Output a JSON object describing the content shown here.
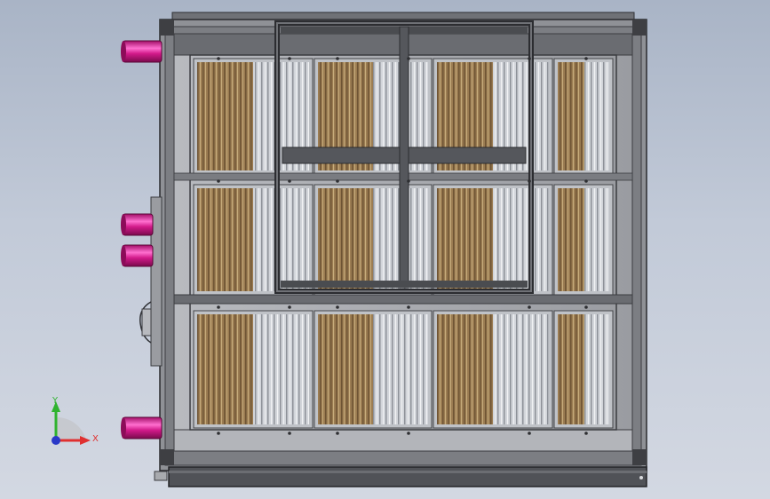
{
  "view": {
    "model": "air-handling-unit-heat-exchanger",
    "background_top": "#a9b4c6",
    "background_bottom": "#d3d8e2"
  },
  "colors": {
    "frame": "#5f6166",
    "frame_dark": "#3a3b3f",
    "panel": "#a8aaae",
    "pipe": "#d21a8a",
    "pipe_highlight": "#ff6fcf",
    "fin_wood_a": "#8e7048",
    "fin_wood_b": "#b49a6c",
    "fin_metal_a": "#c9ccd2",
    "fin_metal_b": "#9fa3aa"
  },
  "coil_grid": {
    "rows": 3,
    "cols": 4
  },
  "pipes": [
    {
      "name": "pipe-top"
    },
    {
      "name": "pipe-middle-upper"
    },
    {
      "name": "pipe-middle-lower"
    },
    {
      "name": "pipe-bottom"
    }
  ],
  "triad": {
    "x_label": "X",
    "y_label": "Y",
    "x_color": "#e03030",
    "y_color": "#2fb32f",
    "z_color": "#2a39c8"
  }
}
